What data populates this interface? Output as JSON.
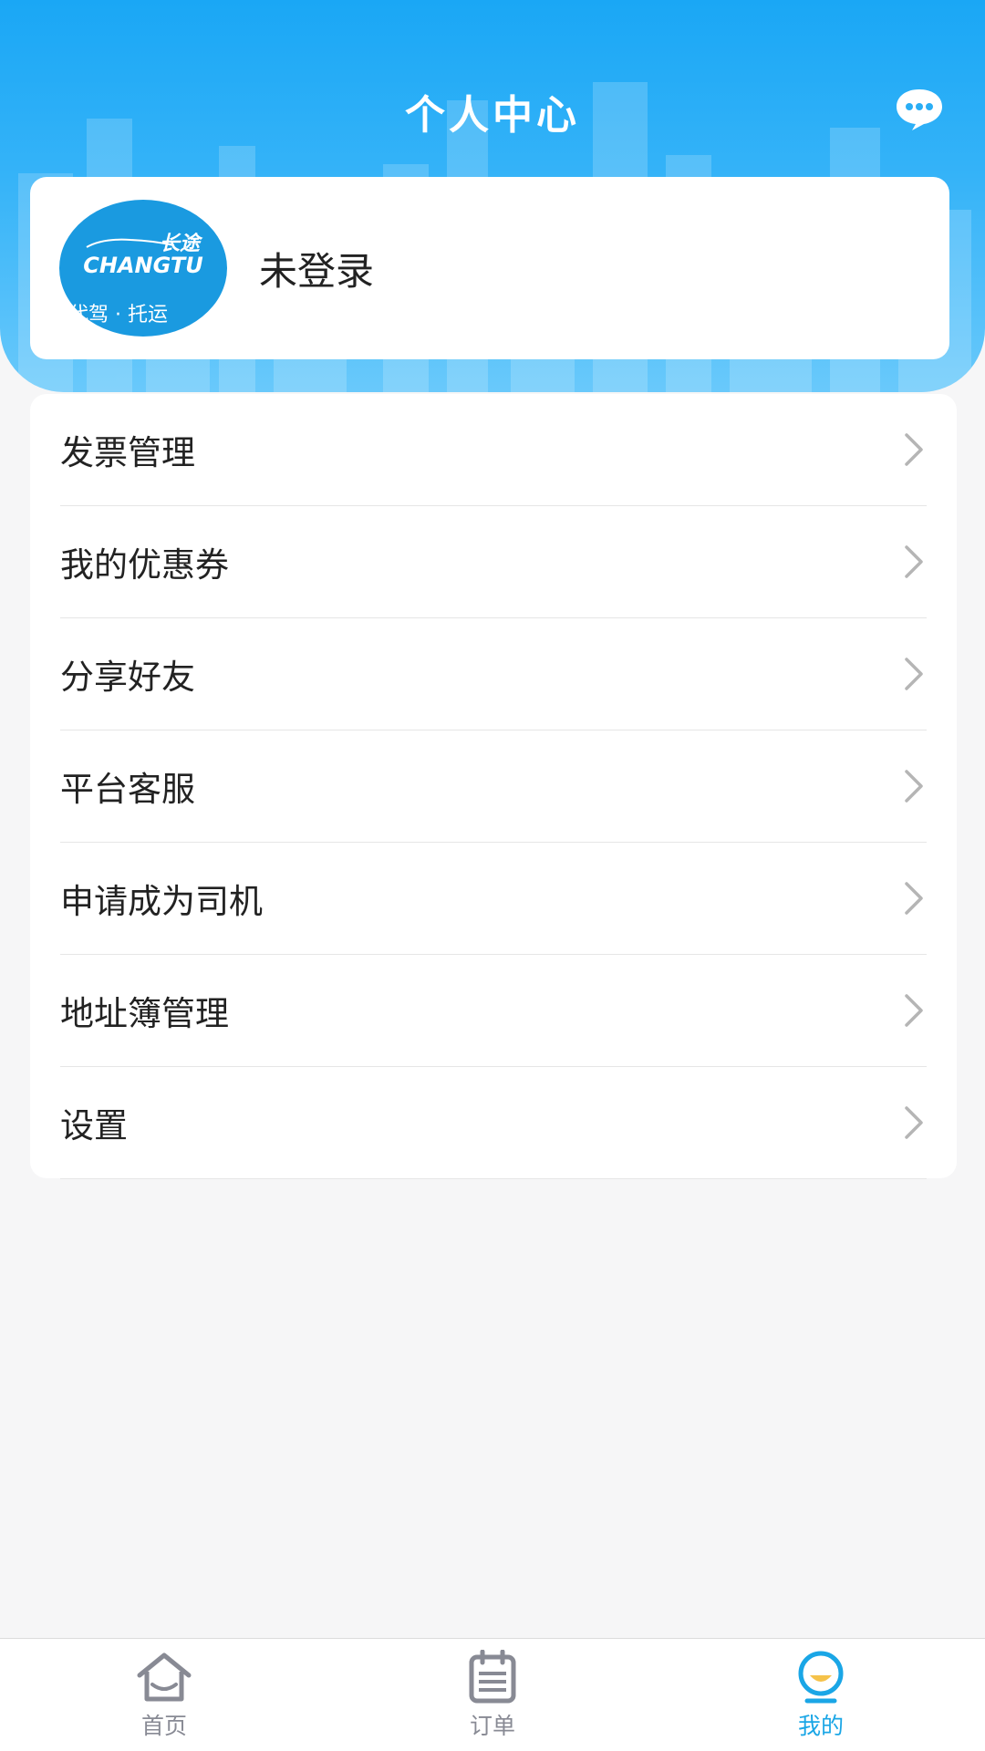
{
  "header": {
    "title": "个人中心",
    "message_icon": "chat-bubble-icon"
  },
  "profile": {
    "logo_text_cn": "长途",
    "logo_text_en": "CHANGTU",
    "logo_subtitle": "代驾 · 托运",
    "login_status": "未登录"
  },
  "menu": {
    "items": [
      {
        "label": "发票管理"
      },
      {
        "label": "我的优惠券"
      },
      {
        "label": "分享好友"
      },
      {
        "label": "平台客服"
      },
      {
        "label": "申请成为司机"
      },
      {
        "label": "地址簿管理"
      },
      {
        "label": "设置"
      }
    ]
  },
  "tabbar": {
    "tabs": [
      {
        "label": "首页",
        "icon": "home-icon"
      },
      {
        "label": "订单",
        "icon": "orders-icon"
      },
      {
        "label": "我的",
        "icon": "profile-icon",
        "active": true
      }
    ]
  },
  "colors": {
    "brand": "#1aa7f5",
    "active_tab": "#1aa6e6",
    "inactive_tab": "#888a94"
  }
}
